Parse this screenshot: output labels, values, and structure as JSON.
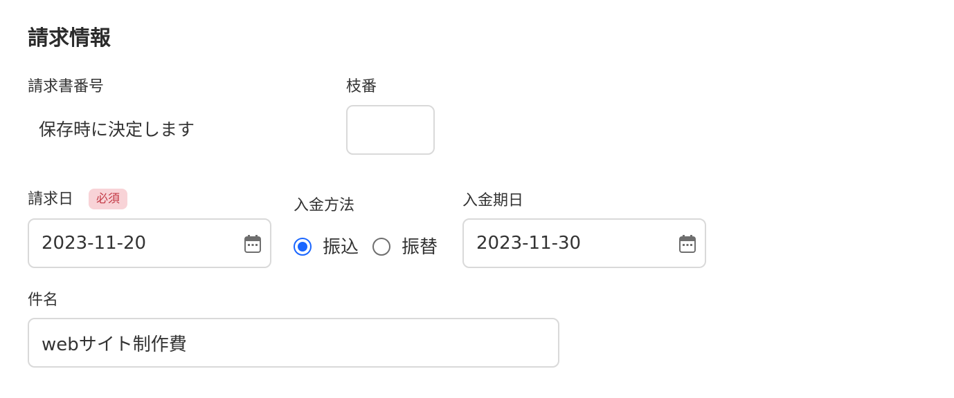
{
  "section": {
    "title": "請求情報"
  },
  "invoice_number": {
    "label": "請求書番号",
    "value": "保存時に決定します"
  },
  "branch_number": {
    "label": "枝番",
    "value": ""
  },
  "invoice_date": {
    "label": "請求日",
    "required_badge": "必須",
    "value": "2023-11-20",
    "icon": "calendar-icon"
  },
  "payment_method": {
    "label": "入金方法",
    "options": [
      {
        "label": "振込",
        "selected": true
      },
      {
        "label": "振替",
        "selected": false
      }
    ],
    "accent_color": "#1a66ff"
  },
  "due_date": {
    "label": "入金期日",
    "value": "2023-11-30",
    "icon": "calendar-icon"
  },
  "subject": {
    "label": "件名",
    "value": "webサイト制作費"
  },
  "colors": {
    "border": "#d9d9d9",
    "badge_bg": "#f8d3d7",
    "badge_text": "#c43b47"
  }
}
